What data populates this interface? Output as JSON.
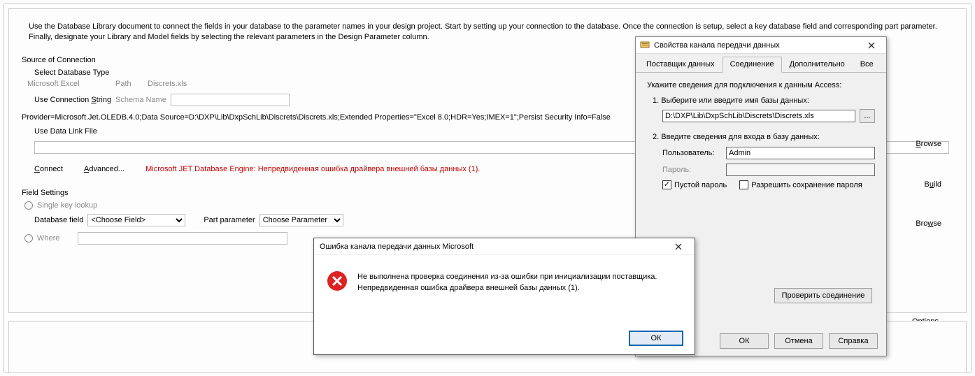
{
  "instructions": "Use the Database Library document to connect the fields in your database to the parameter names in your design project. Start by setting up your connection to the database. Once the connection is setup, select a key database field and corresponding part parameter. Finally, designate your Library and Model fields by selecting the relevant parameters in the Design Parameter column.",
  "source": {
    "title": "Source of Connection",
    "select_type": "Select Database Type",
    "ms_excel": "Microsoft Excel",
    "path_label": "Path",
    "path_value": "Discrets.xls",
    "use_conn": "Use Connection String",
    "schema_label": "Schema Name",
    "conn_string": "Provider=Microsoft.Jet.OLEDB.4.0;Data Source=D:\\DXP\\Lib\\DxpSchLib\\Discrets\\Discrets.xls;Extended Properties=\"Excel 8.0;HDR=Yes;IMEX=1\";Persist Security Info=False",
    "use_datalink": "Use Data Link File",
    "connect": "Connect",
    "advanced": "Advanced...",
    "error": "Microsoft JET Database Engine: Непредвиденная ошибка драйвера внешней базы данных (1)."
  },
  "fields": {
    "title": "Field Settings",
    "single_key": "Single key lookup",
    "db_field": "Database field",
    "choose_field": "<Choose Field>",
    "part_param": "Part parameter",
    "choose_param": "Choose Parameter",
    "where": "Where"
  },
  "right": {
    "browse": "Browse",
    "build": "Build",
    "browse2": "Browse",
    "options": "Options..."
  },
  "props": {
    "title": "Свойства канала передачи данных",
    "tabs": [
      "Поставщик данных",
      "Соединение",
      "Дополнительно",
      "Все"
    ],
    "hint": "Укажите сведения для подключения к данным Access:",
    "step1": "1. Выберите или введите имя базы данных:",
    "db_path": "D:\\DXP\\Lib\\DxpSchLib\\Discrets\\Discrets.xls",
    "browse_btn": "...",
    "step2": "2. Введите сведения для входа в базу данных:",
    "user_label": "Пользователь:",
    "user_value": "Admin",
    "pass_label": "Пароль:",
    "empty_pass": "Пустой пароль",
    "save_pass": "Разрешить сохранение пароля",
    "test_conn": "Проверить соединение",
    "ok": "ОК",
    "cancel": "Отмена",
    "help": "Справка"
  },
  "err": {
    "title": "Ошибка канала передачи данных Microsoft",
    "message": "Не выполнена проверка соединения из-за ошибки при инициализации поставщика. Непредвиденная ошибка драйвера внешней базы данных (1).",
    "ok": "ОК"
  }
}
